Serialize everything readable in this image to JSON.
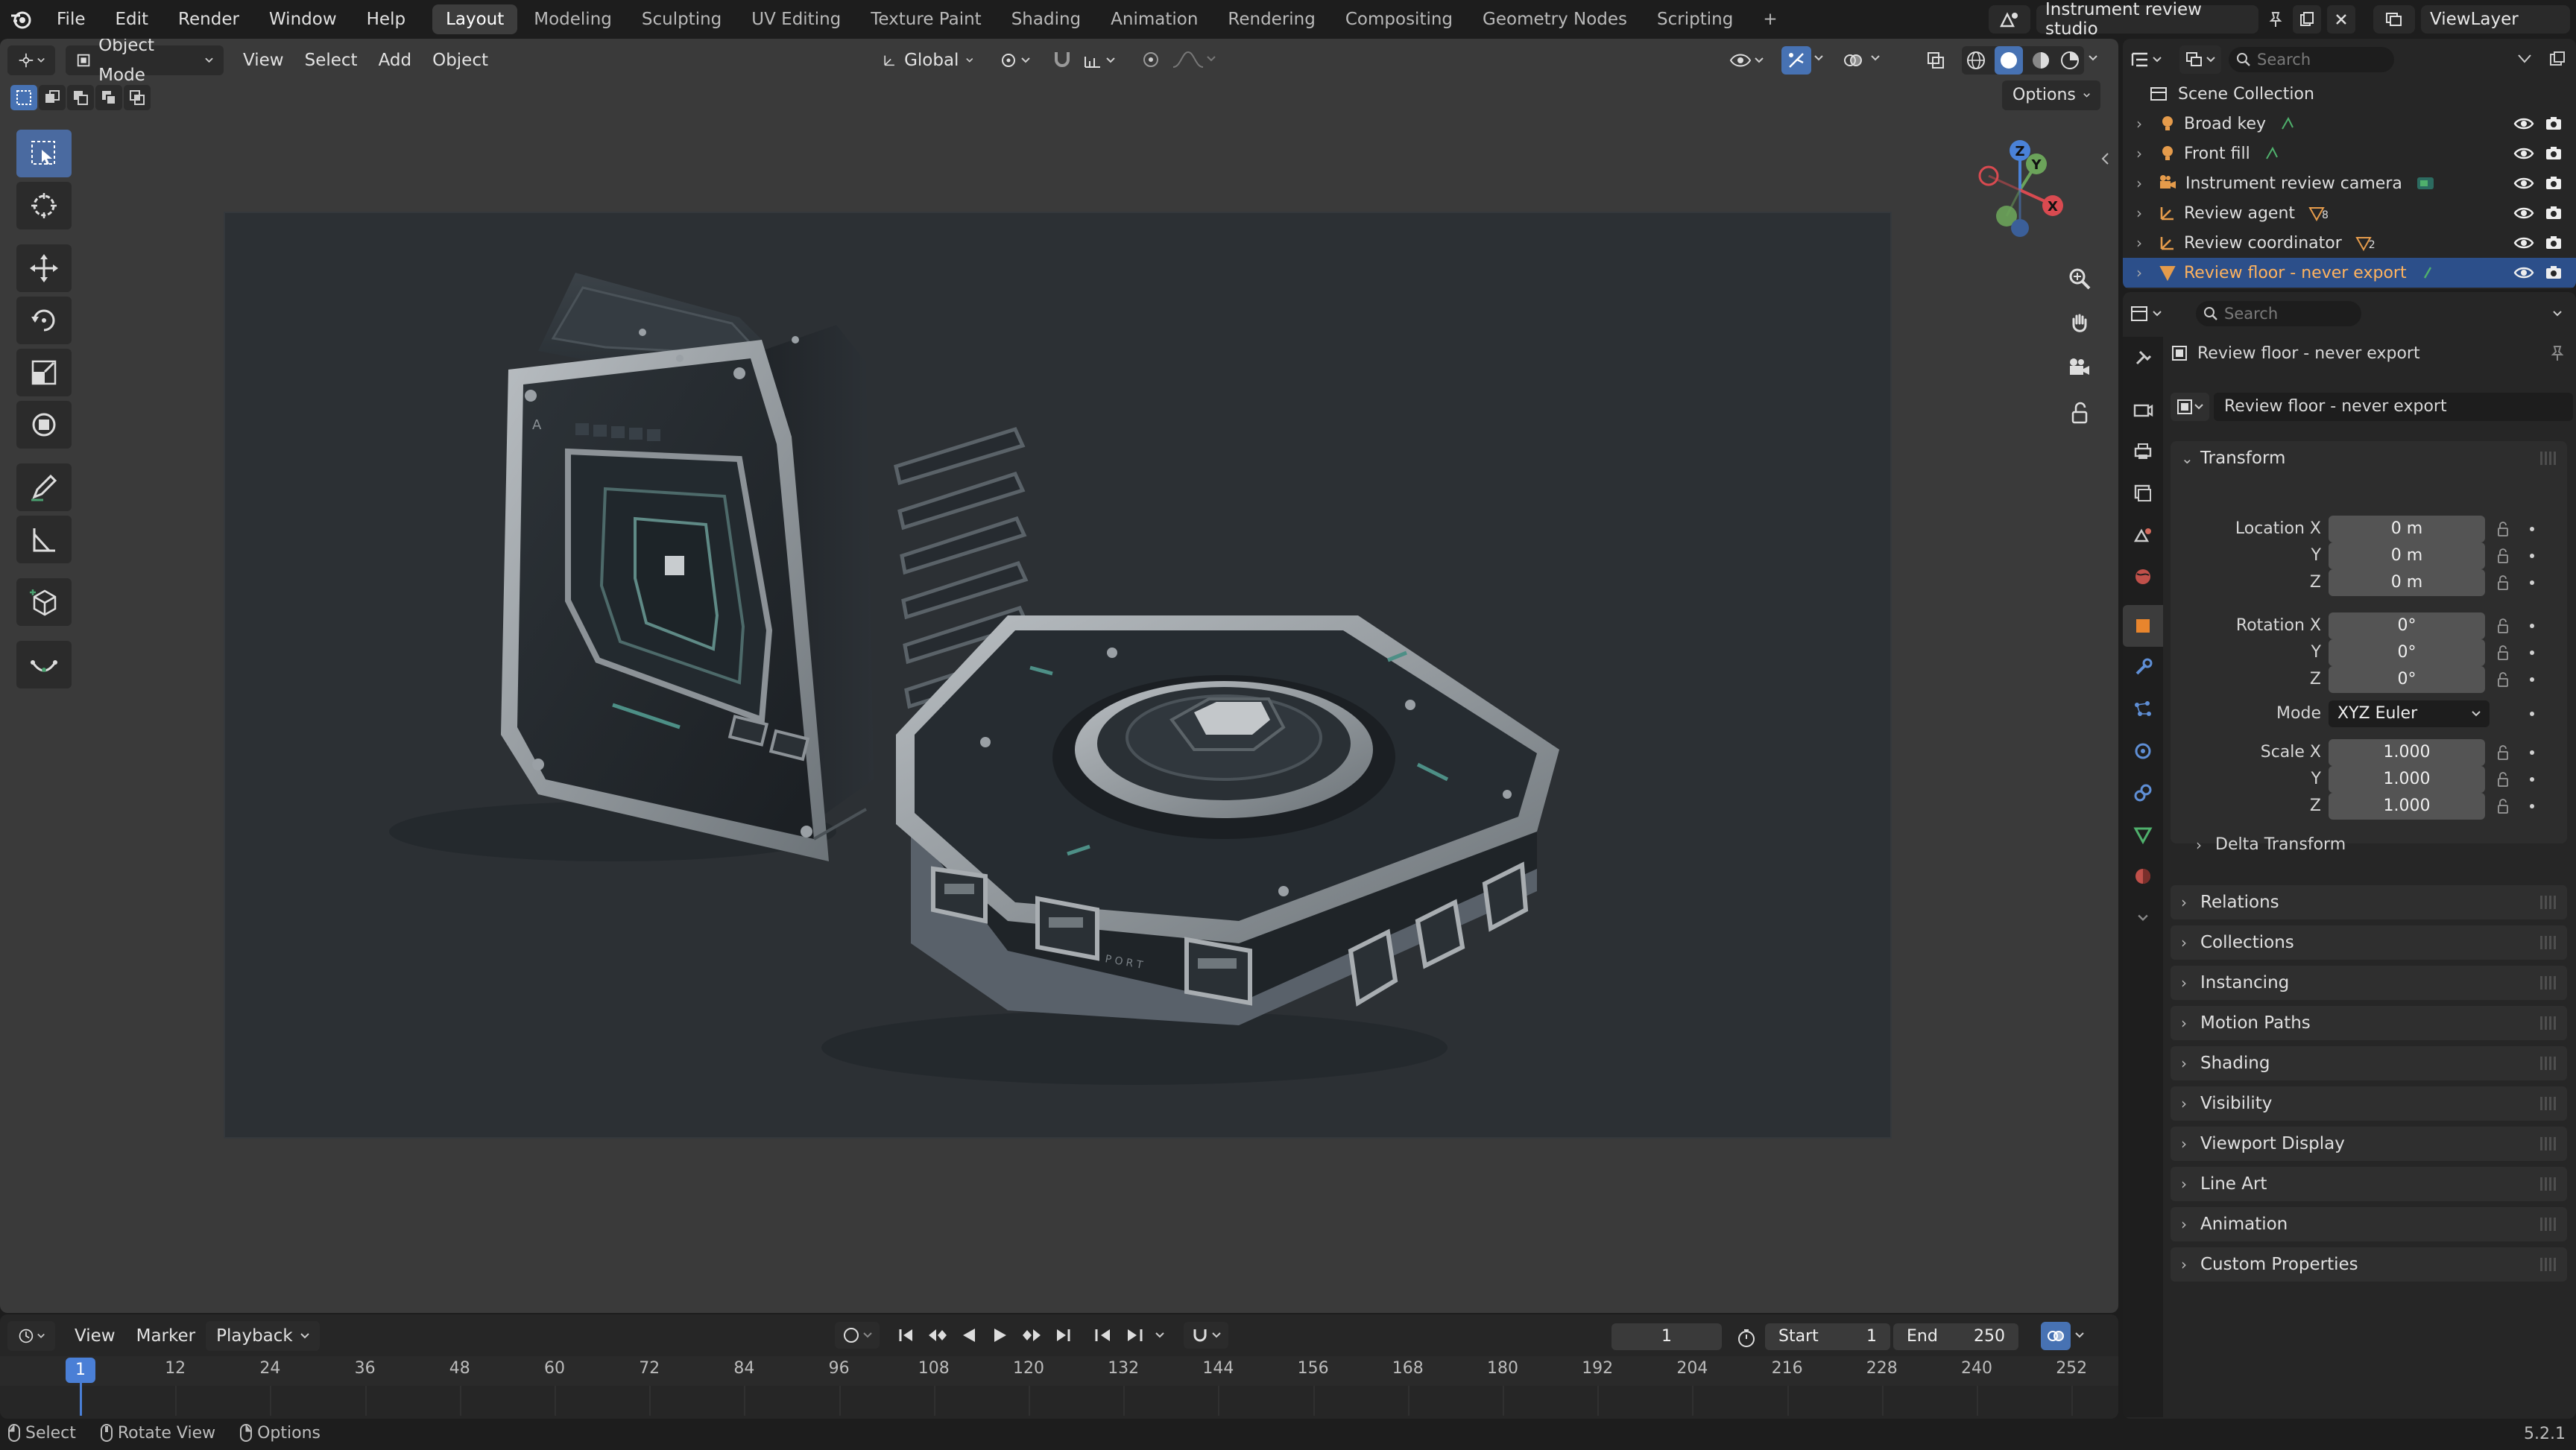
{
  "topbar": {
    "menus": [
      "File",
      "Edit",
      "Render",
      "Window",
      "Help"
    ],
    "workspaces": [
      "Layout",
      "Modeling",
      "Sculpting",
      "UV Editing",
      "Texture Paint",
      "Shading",
      "Animation",
      "Rendering",
      "Compositing",
      "Geometry Nodes",
      "Scripting"
    ],
    "active_workspace": "Layout",
    "add_tab": "+",
    "scene_name": "Instrument review studio",
    "view_layer": "ViewLayer"
  },
  "viewport": {
    "mode": "Object Mode",
    "menus": [
      "View",
      "Select",
      "Add",
      "Object"
    ],
    "orientation": "Global",
    "options_label": "Options",
    "gizmo_labels": {
      "x": "X",
      "y": "Y",
      "z": "Z"
    }
  },
  "timeline": {
    "menus": [
      "View",
      "Marker",
      "Playback"
    ],
    "current_frame": "1",
    "start_label": "Start",
    "start": "1",
    "end_label": "End",
    "end": "250",
    "ticks": [
      "1",
      "12",
      "24",
      "36",
      "48",
      "60",
      "72",
      "84",
      "96",
      "108",
      "120",
      "132",
      "144",
      "156",
      "168",
      "180",
      "192",
      "204",
      "216",
      "228",
      "240",
      "252"
    ]
  },
  "statusbar": {
    "items": [
      "Select",
      "Rotate View",
      "Options"
    ],
    "version": "5.2.1"
  },
  "outliner": {
    "search_placeholder": "Search",
    "root": "Scene Collection",
    "items": [
      {
        "name": "Broad key",
        "type": "light"
      },
      {
        "name": "Front fill",
        "type": "light"
      },
      {
        "name": "Instrument review camera",
        "type": "camera"
      },
      {
        "name": "Review agent",
        "type": "empty",
        "badge": "8"
      },
      {
        "name": "Review coordinator",
        "type": "empty",
        "badge": "2"
      },
      {
        "name": "Review floor - never export",
        "type": "mesh",
        "selected": true
      }
    ]
  },
  "properties": {
    "search_placeholder": "Search",
    "object_title": "Review floor - never export",
    "object_name": "Review floor - never export",
    "transform": {
      "header": "Transform",
      "location_label": "Location X",
      "y_label": "Y",
      "z_label": "Z",
      "location": [
        "0 m",
        "0 m",
        "0 m"
      ],
      "rotation_label": "Rotation X",
      "rotation": [
        "0°",
        "0°",
        "0°"
      ],
      "mode_label": "Mode",
      "mode": "XYZ Euler",
      "scale_label": "Scale X",
      "scale": [
        "1.000",
        "1.000",
        "1.000"
      ],
      "delta": "Delta Transform"
    },
    "panels": [
      "Relations",
      "Collections",
      "Instancing",
      "Motion Paths",
      "Shading",
      "Visibility",
      "Viewport Display",
      "Line Art",
      "Animation",
      "Custom Properties"
    ]
  },
  "colors": {
    "accent": "#4772b3",
    "selected_row": "#2c4f8a",
    "selected_text": "#ffb35e",
    "frame_indicator": "#4a7fd6"
  }
}
